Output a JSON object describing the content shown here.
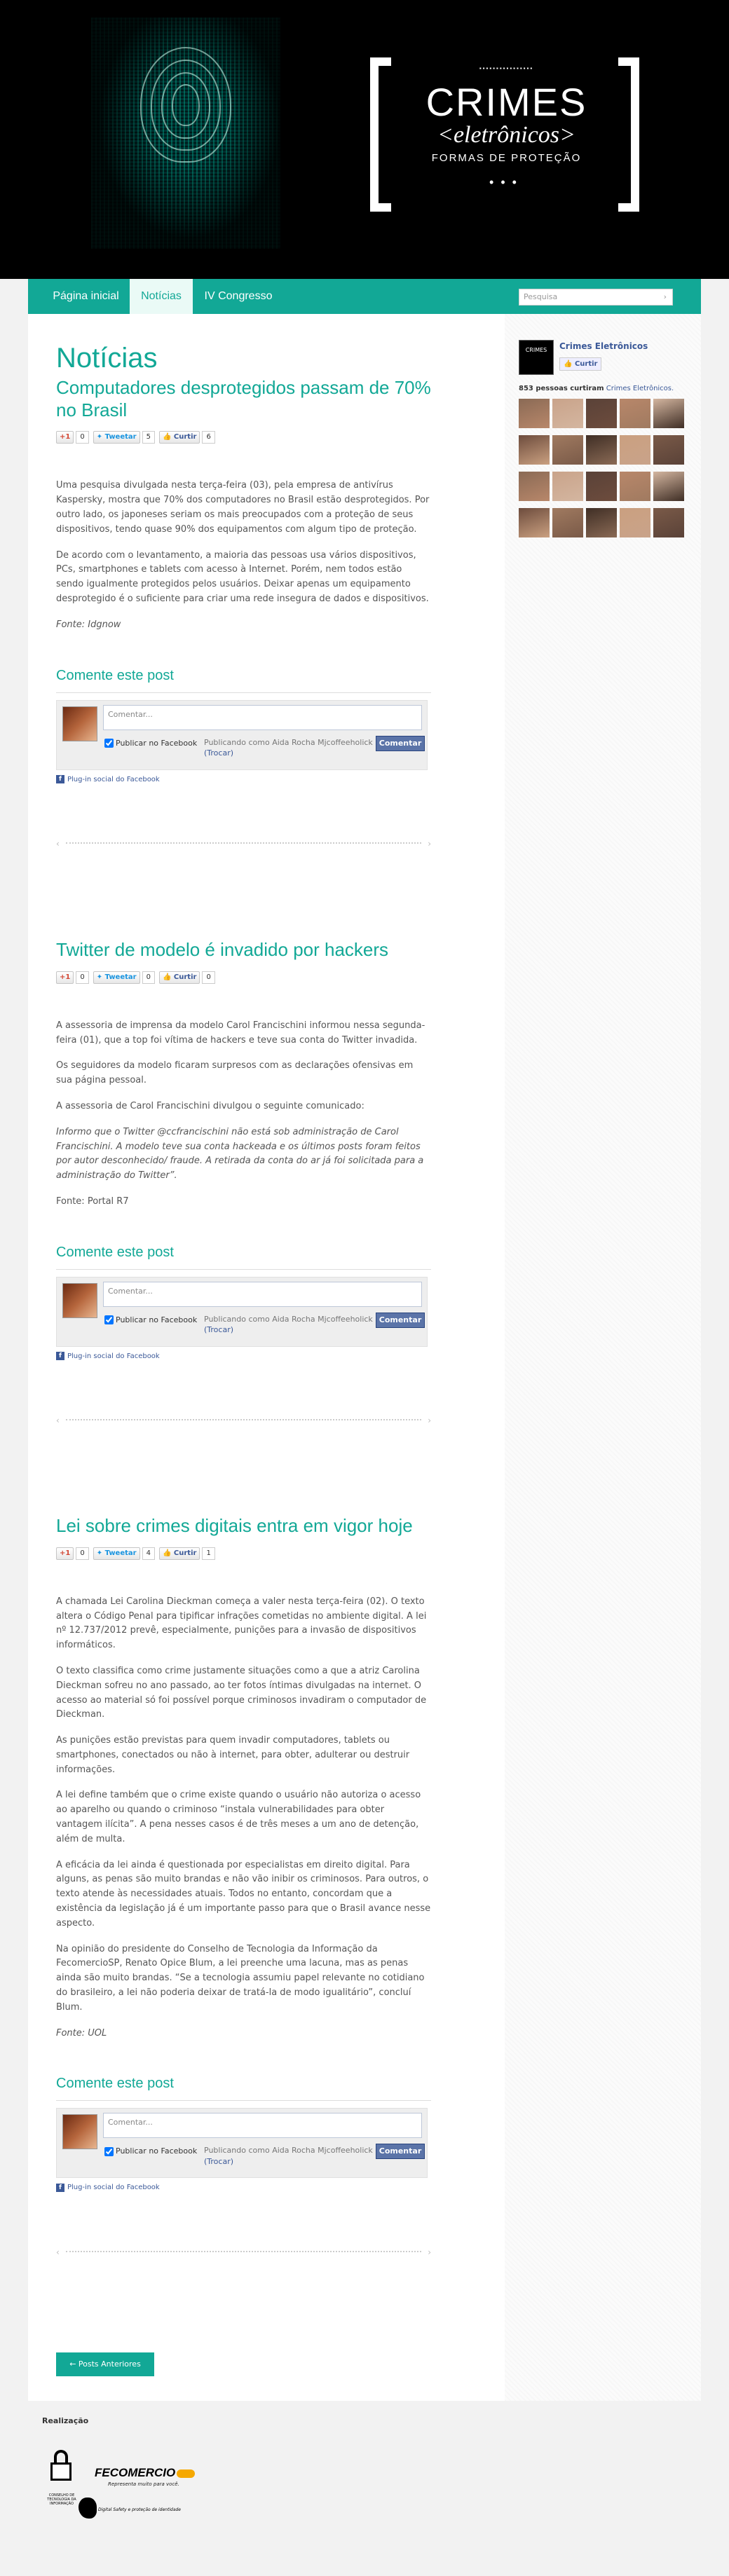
{
  "header": {
    "logo_top": "▪▪▪▪▪▪▪▪▪▪▪▪▪▪▪▪",
    "logo_title": "CRIMES",
    "logo_subtitle": "<eletrônicos>",
    "logo_tagline": "FORMAS DE PROTEÇÃO",
    "logo_dots": "•••"
  },
  "nav": {
    "items": [
      {
        "label": "Página inicial"
      },
      {
        "label": "Notícias"
      },
      {
        "label": "IV Congresso"
      }
    ],
    "search_placeholder": "Pesquisa",
    "search_arrow": "›"
  },
  "page_title": "Notícias",
  "share_labels": {
    "gplus": "+1",
    "tweet": "Tweetar",
    "like": "Curtir"
  },
  "comments_label": "Comente este post",
  "comment_box": {
    "placeholder": "Comentar...",
    "publish_fb": "Publicar no Facebook",
    "publishing_as": "Publicando como Aida Rocha Mjcoffeeholick",
    "switch": "(Trocar)",
    "submit": "Comentar",
    "plugin": "Plug-in social do Facebook"
  },
  "posts": [
    {
      "title": "Computadores desprotegidos passam de 70% no Brasil",
      "gplus_count": "0",
      "tweet_count": "5",
      "like_count": "6",
      "paragraphs": [
        "Uma pesquisa divulgada nesta terça-feira (03),  pela empresa de antivírus Kaspersky, mostra que 70% dos computadores no Brasil estão desprotegidos. Por outro lado, os japoneses seriam os mais preocupados com a proteção de seus dispositivos, tendo quase 90% dos equipamentos com algum tipo de proteção.",
        "De acordo com o levantamento, a maioria das pessoas usa vários dispositivos, PCs, smartphones e tablets com acesso à Internet. Porém, nem todos estão sendo igualmente protegidos pelos usuários. Deixar apenas um equipamento desprotegido é o suficiente para criar uma rede insegura de dados e dispositivos.",
        "Fonte: Idgnow"
      ]
    },
    {
      "title": "Twitter de modelo é invadido por hackers",
      "gplus_count": "0",
      "tweet_count": "0",
      "like_count": "0",
      "paragraphs": [
        "A assessoria de imprensa da modelo Carol Francischini informou nessa segunda-feira (01), que a top foi vítima de hackers e teve sua conta do Twitter invadida.",
        "Os seguidores da modelo ficaram surpresos com as declarações ofensivas em sua página pessoal.",
        "A assessoria de Carol Francischini divulgou o seguinte comunicado:",
        "Informo que o Twitter @ccfrancischini não está sob administração de Carol Francischini. A modelo teve sua conta hackeada e os últimos posts foram feitos por autor desconhecido/ fraude. A retirada da conta do ar já foi solicitada para a administração do Twitter”.",
        "Fonte: Portal R7"
      ]
    },
    {
      "title": "Lei sobre crimes digitais entra em vigor hoje",
      "gplus_count": "0",
      "tweet_count": "4",
      "like_count": "1",
      "paragraphs": [
        "A chamada Lei Carolina Dieckman começa a valer nesta terça-feira (02). O texto altera o Código Penal para tipificar infrações cometidas no ambiente digital. A lei nº 12.737/2012 prevê, especialmente, punições para a invasão de dispositivos informáticos.",
        "O texto classifica como crime justamente situações como a que a atriz Carolina Dieckman sofreu no ano passado, ao ter fotos íntimas divulgadas na internet. O acesso ao material só foi possível porque criminosos invadiram o computador de Dieckman.",
        "As punições estão previstas para quem invadir computadores, tablets ou smartphones, conectados ou não à internet, para obter, adulterar ou destruir informações.",
        "A lei define também que o crime existe quando o usuário não autoriza o acesso ao aparelho ou quando o criminoso “instala vulnerabilidades para obter vantagem ilícita”. A pena nesses casos é de três meses a um ano de detenção, além de multa.",
        "A eficácia da lei ainda é questionada por especialistas em direito digital. Para alguns, as penas são muito brandas e não vão inibir os criminosos. Para outros, o texto atende às necessidades atuais. Todos no entanto, concordam que a existência da legislação já é um importante passo para que o Brasil avance nesse aspecto.",
        "Na opinião do presidente do Conselho de Tecnologia da Informação da FecomercioSP, Renato Opice Blum, a lei preenche uma lacuna, mas as penas ainda são muito brandas. “Se a tecnologia assumiu papel relevante no cotidiano do brasileiro, a lei não poderia deixar de tratá-la de modo igualitário”, concluí Blum.",
        "Fonte: UOL"
      ]
    }
  ],
  "older_posts": "← Posts Anteriores",
  "sidebar": {
    "page_name": "Crimes Eletrônicos",
    "logo_text": "CRIMES",
    "like_label": "Curtir",
    "likes_text": "853 pessoas curtiram",
    "likes_page": "Crimes Eletrônicos."
  },
  "footer": {
    "title": "Realização",
    "lock_caption": "CONSELHO DE TECNOLOGIA DA INFORMAÇÃO",
    "fecomercio": "FECOMERCIO",
    "fecomercio_tag": "Representa muito para você.",
    "bird_caption": "Digital Safety e proteção de identidade"
  }
}
